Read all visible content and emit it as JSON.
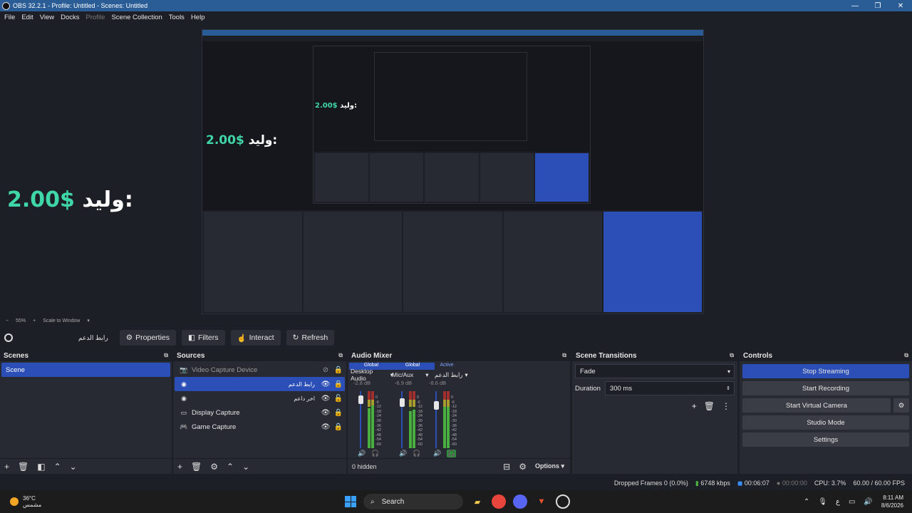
{
  "window": {
    "title": "OBS 32.2.1 - Profile: Untitled - Scenes: Untitled"
  },
  "menu": [
    "File",
    "Edit",
    "View",
    "Docks",
    "Profile",
    "Scene Collection",
    "Tools",
    "Help"
  ],
  "preview": {
    "price_label": "وليد:",
    "price_value": "2.00$",
    "zoom": "55%",
    "scale_mode": "Scale to Window"
  },
  "source_toolbar": {
    "selected_source": "رابط الدعم",
    "properties": "Properties",
    "filters": "Filters",
    "interact": "Interact",
    "refresh": "Refresh"
  },
  "scenes": {
    "title": "Scenes",
    "items": [
      "Scene"
    ]
  },
  "sources": {
    "title": "Sources",
    "items": [
      {
        "name": "Video Capture Device",
        "icon": "camera-icon"
      },
      {
        "name": "رابط الدعم",
        "icon": "browser-icon"
      },
      {
        "name": "اخر داعم",
        "icon": "browser-icon"
      },
      {
        "name": "Display Capture",
        "icon": "monitor-icon"
      },
      {
        "name": "Game Capture",
        "icon": "gamepad-icon"
      }
    ]
  },
  "audio_mixer": {
    "title": "Audio Mixer",
    "channels": [
      {
        "tag": "Global",
        "name": "Desktop Audio",
        "db": "-2.8 dB"
      },
      {
        "tag": "Global",
        "name": "Mic/Aux",
        "db": "-6.9 dB"
      },
      {
        "tag": "Active",
        "name": "رابط الدعم",
        "db": "-8.6 dB"
      }
    ],
    "scale": [
      "0",
      "-6",
      "-12",
      "-18",
      "-24",
      "-30",
      "-36",
      "-42",
      "-48",
      "-54",
      "-60"
    ],
    "hidden": "0 hidden",
    "options": "Options"
  },
  "transitions": {
    "title": "Scene Transitions",
    "selected": "Fade",
    "duration_label": "Duration",
    "duration_value": "300 ms"
  },
  "controls": {
    "title": "Controls",
    "stop_streaming": "Stop Streaming",
    "start_recording": "Start Recording",
    "start_virtual_camera": "Start Virtual Camera",
    "studio_mode": "Studio Mode",
    "settings": "Settings"
  },
  "status": {
    "dropped_frames": "Dropped Frames 0 (0.0%)",
    "bitrate": "6748 kbps",
    "stream_time": "00:06:07",
    "rec_time": "00:00:00",
    "cpu": "CPU: 3.7%",
    "fps": "60.00 / 60.00 FPS"
  },
  "taskbar": {
    "temp": "36°C",
    "weather": "مشمس",
    "search": "Search",
    "lang": "ع",
    "time": "8:11 AM",
    "date": "8/6/2026"
  },
  "colors": {
    "accent": "#2b4fb6",
    "price": "#3fd6a8",
    "titlebar": "#2a5d96"
  }
}
